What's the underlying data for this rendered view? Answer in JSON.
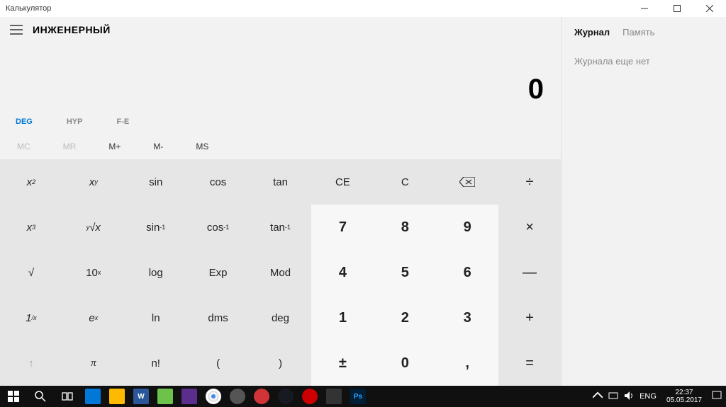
{
  "window": {
    "title": "Калькулятор"
  },
  "header": {
    "mode": "ИНЖЕНЕРНЫЙ"
  },
  "display": {
    "value": "0"
  },
  "toggles": {
    "deg": "DEG",
    "hyp": "HYP",
    "fe": "F-E"
  },
  "memory": {
    "mc": "MC",
    "mr": "MR",
    "mplus": "M+",
    "mminus": "M-",
    "ms": "MS"
  },
  "side": {
    "tabs": {
      "history": "Журнал",
      "memory": "Память"
    },
    "empty": "Журнала еще нет"
  },
  "btns": {
    "xsq": "x",
    "xsq_sup": "2",
    "xy": "x",
    "xy_sup": "y",
    "sin": "sin",
    "cos": "cos",
    "tan": "tan",
    "ce": "CE",
    "c": "C",
    "div": "÷",
    "xcu": "x",
    "xcu_sup": "3",
    "yrootpre": "y",
    "yroot": "√x",
    "asin": "sin",
    "asin_sup": "-1",
    "acos": "cos",
    "acos_sup": "-1",
    "atan": "tan",
    "atan_sup": "-1",
    "n7": "7",
    "n8": "8",
    "n9": "9",
    "mul": "×",
    "sqrt": "√",
    "tenx": "10",
    "tenx_sup": "x",
    "log": "log",
    "exp": "Exp",
    "mod": "Mod",
    "n4": "4",
    "n5": "5",
    "n6": "6",
    "minus": "—",
    "inv": "1",
    "inv_sub": "/x",
    "ex": "e",
    "ex_sup": "x",
    "ln": "ln",
    "dms": "dms",
    "deg": "deg",
    "n1": "1",
    "n2": "2",
    "n3": "3",
    "plus": "+",
    "up": "↑",
    "pi": "π",
    "nfact": "n!",
    "lparen": "(",
    "rparen": ")",
    "negate": "±",
    "n0": "0",
    "dot": ",",
    "eq": "="
  },
  "tray": {
    "lang": "ENG",
    "time": "22:37",
    "date": "05.05.2017"
  }
}
